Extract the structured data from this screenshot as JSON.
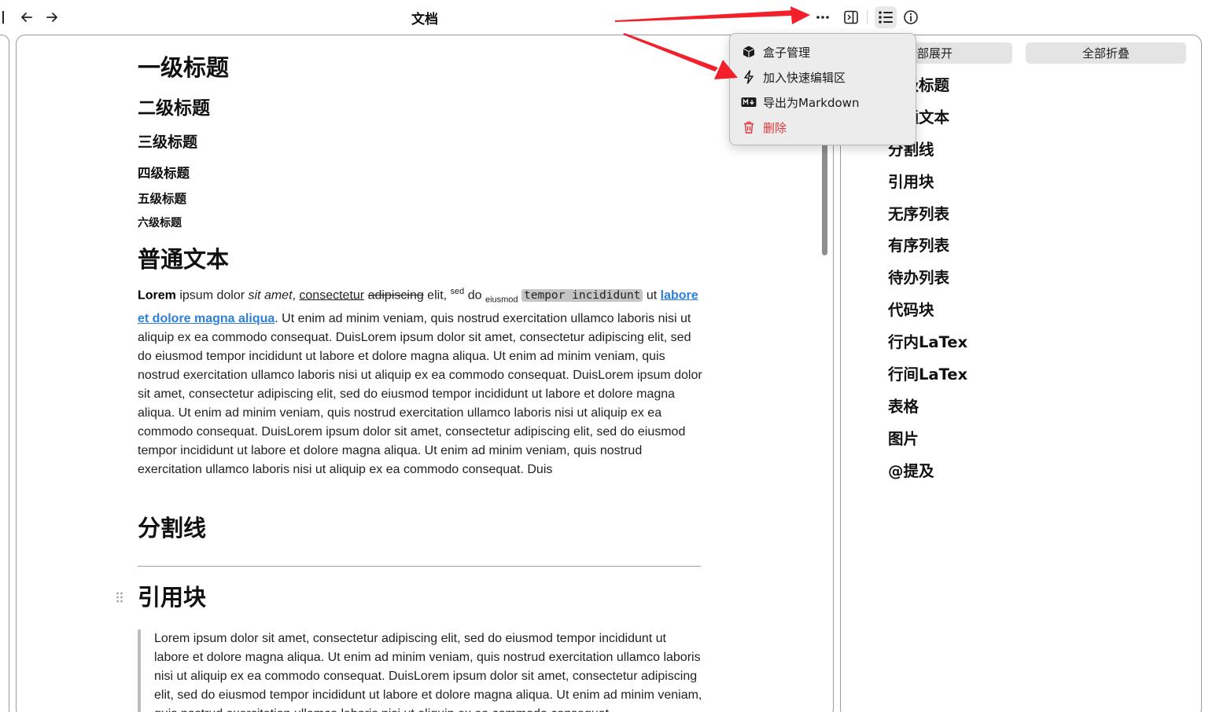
{
  "titlebar": {
    "title": "文档"
  },
  "menu": {
    "items": [
      {
        "label": "盒子管理",
        "icon": "box-icon"
      },
      {
        "label": "加入快速编辑区",
        "icon": "lightning-icon"
      },
      {
        "label": "导出为Markdown",
        "icon": "markdown-icon"
      },
      {
        "label": "删除",
        "icon": "trash-icon",
        "color": "#e0363c"
      }
    ]
  },
  "outline": {
    "expand_label": "全部展开",
    "collapse_label": "全部折叠",
    "items": [
      "一级标题",
      "普通文本",
      "分割线",
      "引用块",
      "无序列表",
      "有序列表",
      "待办列表",
      "代码块",
      "行内LaTex",
      "行间LaTex",
      "表格",
      "图片",
      "@提及"
    ]
  },
  "doc": {
    "h1": "一级标题",
    "h2": "二级标题",
    "h3": "三级标题",
    "h4": "四级标题",
    "h5": "五级标题",
    "h6": "六级标题",
    "section_text": "普通文本",
    "para": {
      "bold": "Lorem",
      "t1": " ipsum dolor ",
      "italic": "sit amet",
      "t2": ", ",
      "underline": "consectetur",
      "t3": " ",
      "strike": "adipiscing",
      "t4": " elit, ",
      "sup": "sed",
      "t5": " do ",
      "sub": "eiusmod",
      "t6": " ",
      "code": "tempor incididunt",
      "t7": " ut ",
      "link": "labore et dolore magna aliqua",
      "rest": ". Ut enim ad minim veniam, quis nostrud exercitation ullamco laboris nisi ut aliquip ex ea commodo consequat. DuisLorem ipsum dolor sit amet, consectetur adipiscing elit, sed do eiusmod tempor incididunt ut labore et dolore magna aliqua. Ut enim ad minim veniam, quis nostrud exercitation ullamco laboris nisi ut aliquip ex ea commodo consequat. DuisLorem ipsum dolor sit amet, consectetur adipiscing elit, sed do eiusmod tempor incididunt ut labore et dolore magna aliqua. Ut enim ad minim veniam, quis nostrud exercitation ullamco laboris nisi ut aliquip ex ea commodo consequat. DuisLorem ipsum dolor sit amet, consectetur adipiscing elit, sed do eiusmod tempor incididunt ut labore et dolore magna aliqua. Ut enim ad minim veniam, quis nostrud exercitation ullamco laboris nisi ut aliquip ex ea commodo consequat. Duis"
    },
    "section_divider": "分割线",
    "section_quote": "引用块",
    "quote_text": "Lorem ipsum dolor sit amet, consectetur adipiscing elit, sed do eiusmod tempor incididunt ut labore et dolore magna aliqua. Ut enim ad minim veniam, quis nostrud exercitation ullamco laboris nisi ut aliquip ex ea commodo consequat. DuisLorem ipsum dolor sit amet, consectetur adipiscing elit, sed do eiusmod tempor incididunt ut labore et dolore magna aliqua. Ut enim ad minim veniam, quis nostrud exercitation ullamco laboris nisi ut aliquip ex ea commodo consequat."
  },
  "colors": {
    "arrow": "#f2202a",
    "link": "#2f7fd8",
    "danger": "#e0363c"
  }
}
